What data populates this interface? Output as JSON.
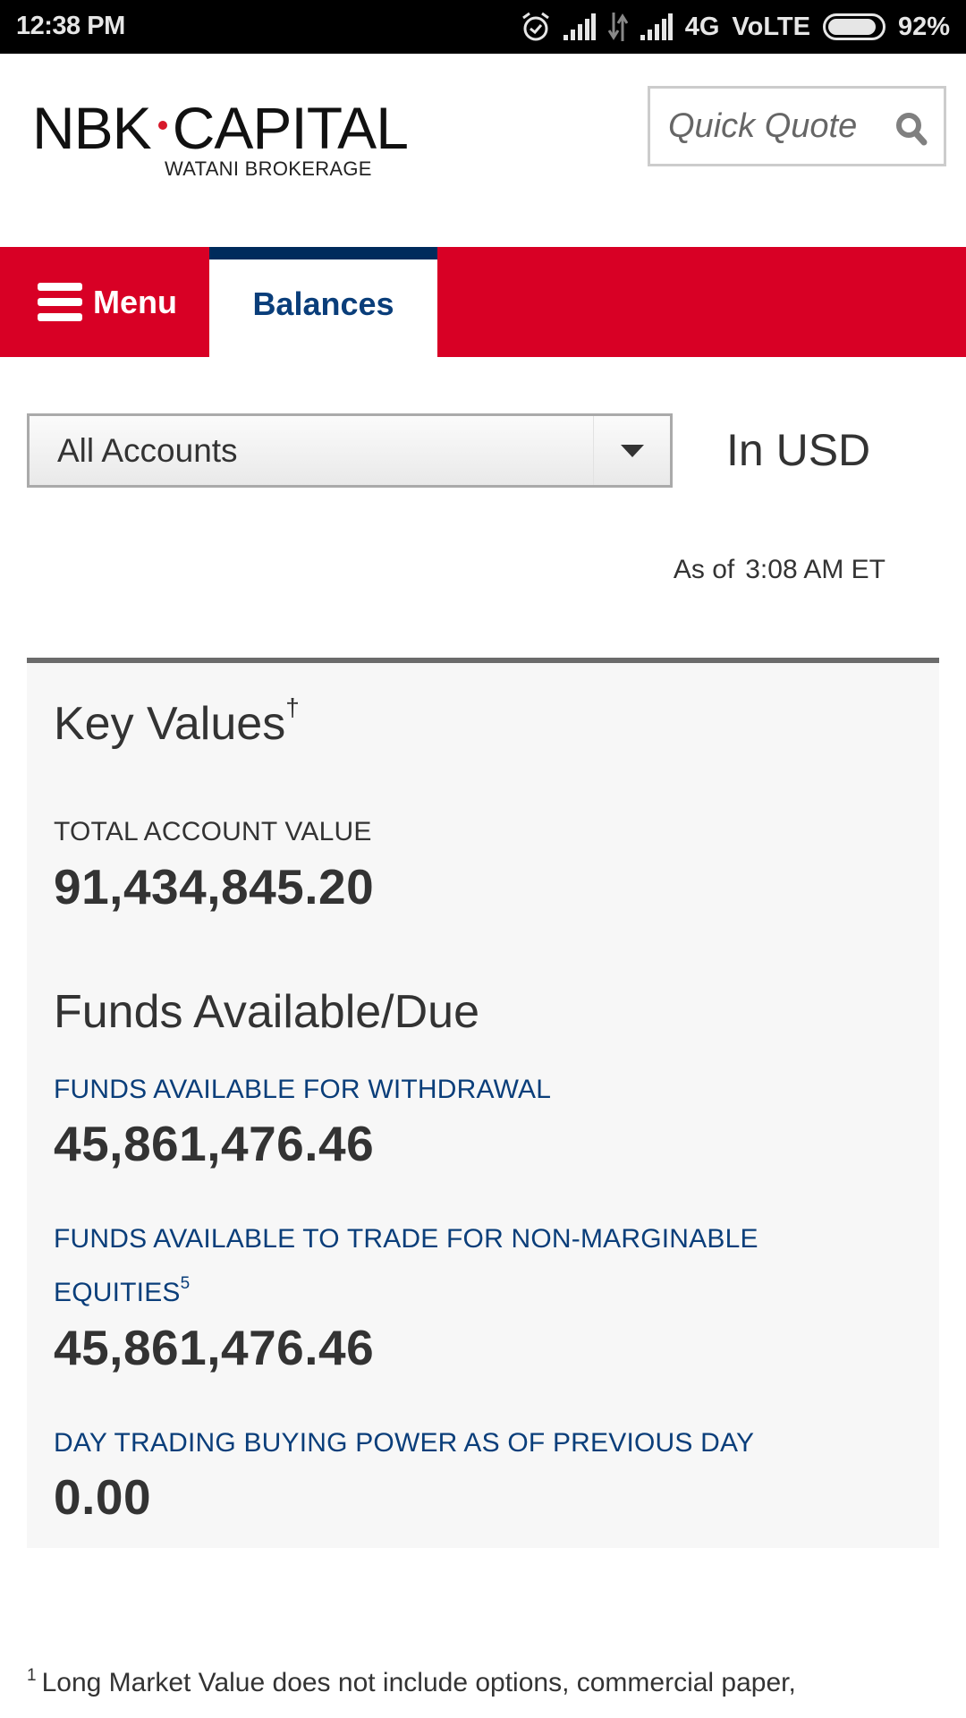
{
  "status_bar": {
    "time": "12:38 PM",
    "network": "4G",
    "volte": "VoLTE",
    "battery": "92%",
    "battery_level": 0.92,
    "icons": [
      "alarm-icon",
      "signal-icon",
      "data-transfer-icon",
      "signal-icon",
      "battery-icon"
    ]
  },
  "header": {
    "logo_left": "NBK",
    "logo_right": "CAPITAL",
    "logo_sub": "WATANI BROKERAGE",
    "logo_dot_color": "#d7182a",
    "quick_quote_placeholder": "Quick Quote",
    "quick_quote_icon": "search-icon"
  },
  "nav": {
    "menu_label": "Menu",
    "menu_icon": "hamburger-icon",
    "active_tab": "Balances",
    "bar_color": "#d80025",
    "active_indicator_color": "#002b5c"
  },
  "filters": {
    "account_selected": "All Accounts",
    "currency_label": "In USD"
  },
  "as_of": {
    "prefix": "As of",
    "time": "3:08 AM ET"
  },
  "key_values": {
    "title": "Key Values",
    "title_mark": "†",
    "total_account_value_label": "TOTAL ACCOUNT VALUE",
    "total_account_value": "91,434,845.20"
  },
  "funds": {
    "title": "Funds Available/Due",
    "items": [
      {
        "label": "FUNDS AVAILABLE FOR WITHDRAWAL",
        "label_line2": "",
        "footnote": "",
        "value": "45,861,476.46"
      },
      {
        "label": "FUNDS AVAILABLE TO TRADE FOR NON-MARGINABLE",
        "label_line2": "EQUITIES",
        "footnote": "5",
        "value": "45,861,476.46"
      },
      {
        "label": "DAY TRADING BUYING POWER AS OF PREVIOUS DAY",
        "label_line2": "",
        "footnote": "",
        "value": "0.00"
      }
    ],
    "label_color": "#0a3e7a"
  },
  "footnote": {
    "number": "1",
    "text": "Long Market Value does not include options, commercial paper,"
  }
}
